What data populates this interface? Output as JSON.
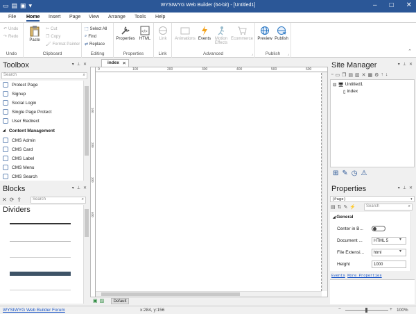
{
  "titlebar": {
    "title": "WYSIWYG Web Builder (64-bit) - [Untitled1]"
  },
  "menu": {
    "file": "File",
    "home": "Home",
    "insert": "Insert",
    "page": "Page",
    "view": "View",
    "arrange": "Arrange",
    "tools": "Tools",
    "help": "Help"
  },
  "ribbon": {
    "undo": "Undo",
    "redo": "Redo",
    "undo_group": "Undo",
    "paste": "Paste",
    "cut": "Cut",
    "copy": "Copy",
    "format_painter": "Format Painter",
    "clipboard_group": "Clipboard",
    "select_all": "Select All",
    "find": "Find",
    "replace": "Replace",
    "editing_group": "Editing",
    "properties": "Properties",
    "html": "HTML",
    "properties_group": "Properties",
    "link": "Link",
    "link_group": "Link",
    "animations": "Animations",
    "events": "Events",
    "motion_effects": "Motion Effects",
    "ecommerce": "Ecommerce",
    "advanced_group": "Advanced",
    "preview": "Preview",
    "publish": "Publish",
    "publish_group": "Publish"
  },
  "toolbox": {
    "title": "Toolbox",
    "search_placeholder": "Search",
    "items": [
      "Protect Page",
      "Signup",
      "Social Login",
      "Single Page Protect",
      "User Redirect"
    ],
    "section": "Content Management",
    "cms_items": [
      "CMS Admin",
      "CMS Card",
      "CMS Label",
      "CMS Menu",
      "CMS Search"
    ]
  },
  "blocks": {
    "title": "Blocks",
    "search_placeholder": "Search",
    "category": "Dividers"
  },
  "document": {
    "tab": "index",
    "ruler_ticks": [
      "0",
      "100",
      "200",
      "300",
      "400",
      "500",
      "600"
    ],
    "vruler_ticks": [
      "100",
      "200",
      "300",
      "400"
    ]
  },
  "site_manager": {
    "title": "Site Manager",
    "root": "Untitled1",
    "page": "index"
  },
  "properties": {
    "title": "Properties",
    "selector": "(Page)",
    "search_placeholder": "Search",
    "section": "General",
    "rows": [
      {
        "label": "Center in B...",
        "value": ""
      },
      {
        "label": "Document ...",
        "value": "HTML 5"
      },
      {
        "label": "File Extensi...",
        "value": "html"
      },
      {
        "label": "Height",
        "value": "1000"
      }
    ],
    "events_link": "Events",
    "more_link": "More Properties"
  },
  "statusbar": {
    "forum": "WYSIWYG Web Builder Forum",
    "coords": "x:284, y:156",
    "layout": "Default",
    "zoom": "100%"
  }
}
